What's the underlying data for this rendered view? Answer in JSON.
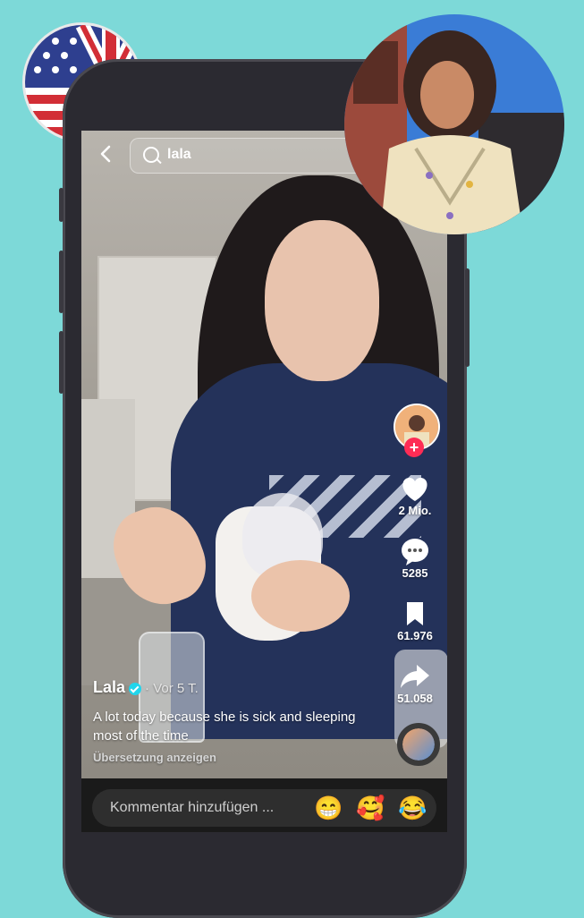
{
  "search": {
    "query": "lala"
  },
  "post": {
    "username": "Lala",
    "posted": "· Vor 5 T.",
    "description": "A lot today because she is sick and sleeping most of the time",
    "translate_label": "Übersetzung anzeigen"
  },
  "actions": {
    "likes": "2 Mio.",
    "comments": "5285",
    "saves": "61.976",
    "shares": "51.058"
  },
  "comment_bar": {
    "placeholder": "Kommentar hinzufügen ...",
    "emojis": [
      "😁",
      "🥰",
      "😂"
    ]
  },
  "icons": [
    "back-icon",
    "search-icon",
    "heart-icon",
    "comment-icon",
    "bookmark-icon",
    "share-icon",
    "follow-plus-icon",
    "verified-icon"
  ],
  "colors": {
    "background": "#7dd9d8",
    "follow": "#fe2c55",
    "verified": "#20d5ec"
  }
}
